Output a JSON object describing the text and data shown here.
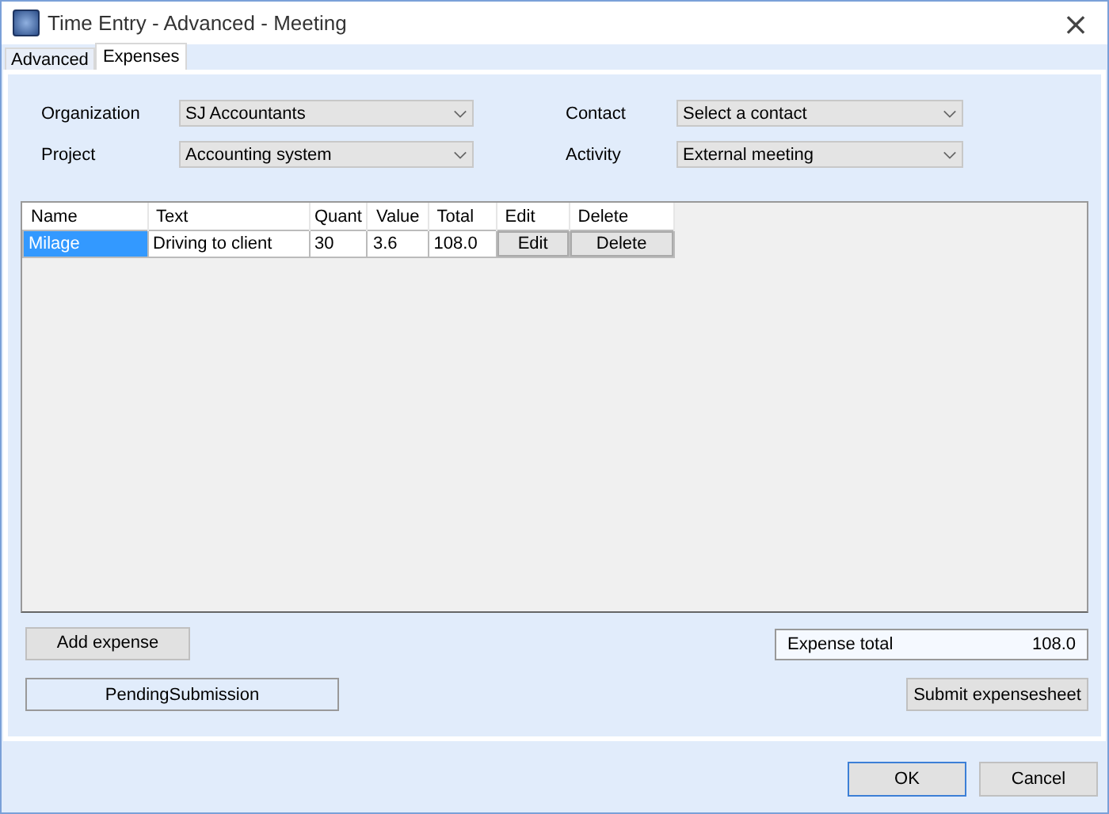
{
  "window": {
    "title": "Time Entry - Advanced - Meeting",
    "close": "×"
  },
  "tabs": [
    {
      "label": "Advanced",
      "selected": false
    },
    {
      "label": "Expenses",
      "selected": true
    }
  ],
  "fields": [
    {
      "label": "Organization",
      "value": "SJ Accountants"
    },
    {
      "label": "Contact",
      "value": "Select a contact"
    },
    {
      "label": "Project",
      "value": "Accounting system"
    },
    {
      "label": "Activity",
      "value": "External meeting"
    }
  ],
  "table": {
    "columns": [
      "Name",
      "Text",
      "Quant",
      "Value",
      "Total",
      "Edit",
      "Delete"
    ],
    "rows": [
      {
        "selected": true,
        "name": "Milage",
        "text": "Driving to client",
        "quantity": "30",
        "value": "3.6",
        "total": "108.0",
        "edit": "Edit",
        "delete": "Delete"
      }
    ]
  },
  "add_button": "Add expense",
  "expense_total": {
    "label": "Expense total",
    "value": "108.0"
  },
  "status": "PendingSubmission",
  "submit_button": "Submit expensesheet",
  "footer_buttons": [
    {
      "label": "OK",
      "default": true
    },
    {
      "label": "Cancel",
      "default": false
    }
  ]
}
